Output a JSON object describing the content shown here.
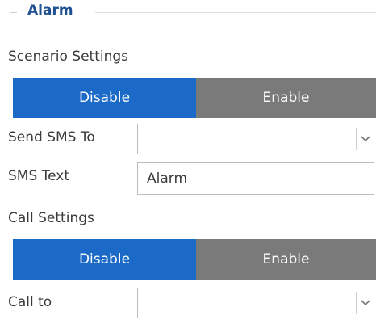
{
  "group": {
    "title": "Alarm"
  },
  "scenario": {
    "label": "Scenario Settings",
    "disable_label": "Disable",
    "enable_label": "Enable",
    "selected": "Disable"
  },
  "send_sms": {
    "label": "Send SMS To",
    "value": ""
  },
  "sms_text": {
    "label": "SMS Text",
    "value": "Alarm"
  },
  "call_settings": {
    "label": "Call Settings",
    "disable_label": "Disable",
    "enable_label": "Enable",
    "selected": "Disable"
  },
  "call_to": {
    "label": "Call to",
    "value": ""
  },
  "colors": {
    "accent": "#1b6ac7",
    "inactive": "#7a7a7a",
    "title": "#1e4f91"
  },
  "icons": {
    "dropdown": "chevron-down-icon"
  }
}
